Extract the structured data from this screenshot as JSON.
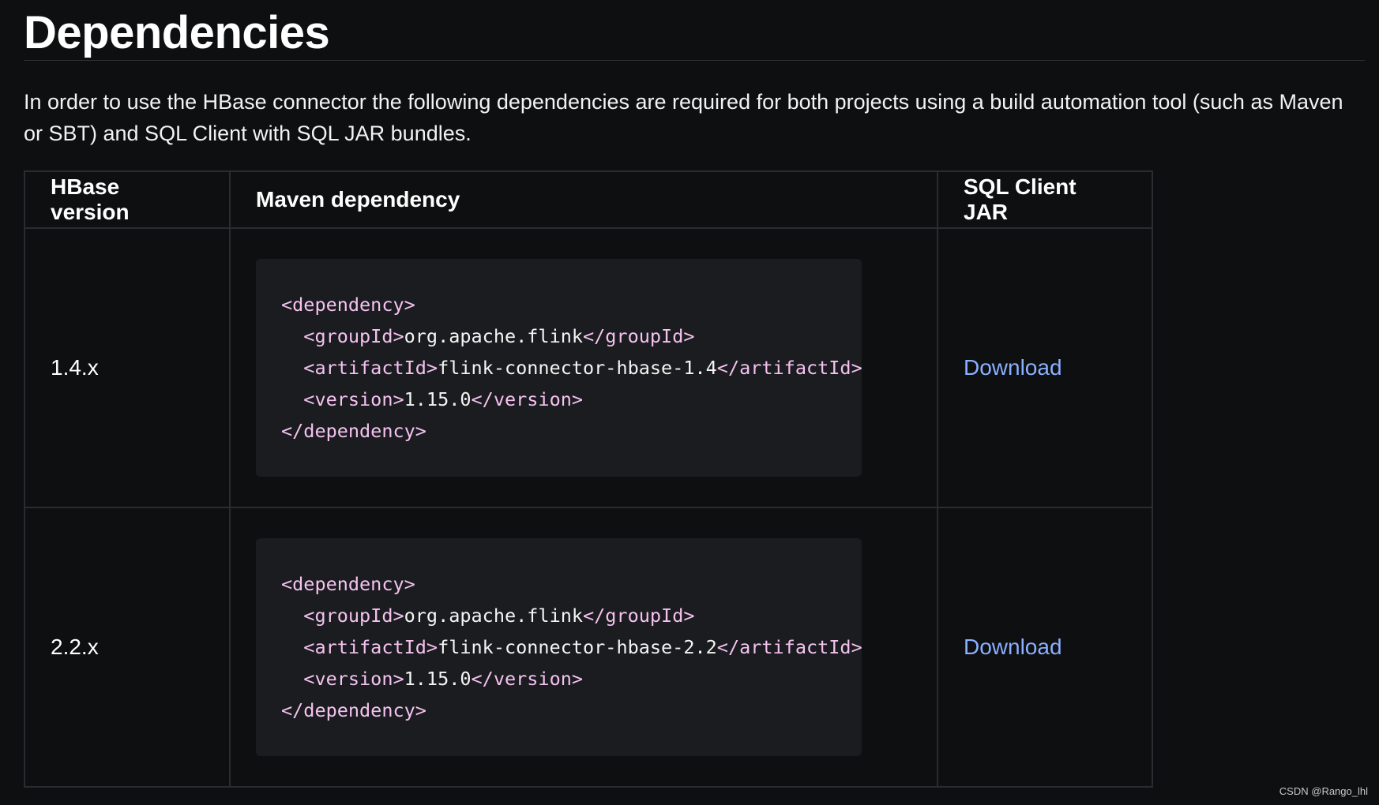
{
  "page": {
    "title": "Dependencies",
    "intro": "In order to use the HBase connector the following dependencies are required for both projects using a build automation tool (such as Maven or SBT) and SQL Client with SQL JAR bundles."
  },
  "table": {
    "headers": [
      "HBase version",
      "Maven dependency",
      "SQL Client JAR"
    ],
    "rows": [
      {
        "version": "1.4.x",
        "code": {
          "l1_open": "<dependency>",
          "l2_open": "<groupId>",
          "l2_val": "org.apache.flink",
          "l2_close": "</groupId>",
          "l3_open": "<artifactId>",
          "l3_val": "flink-connector-hbase-1.4",
          "l3_close": "</artifactId>",
          "l4_open": "<version>",
          "l4_val": "1.15.0",
          "l4_close": "</version>",
          "l5_close": "</dependency>"
        },
        "jar_link": "Download"
      },
      {
        "version": "2.2.x",
        "code": {
          "l1_open": "<dependency>",
          "l2_open": "<groupId>",
          "l2_val": "org.apache.flink",
          "l2_close": "</groupId>",
          "l3_open": "<artifactId>",
          "l3_val": "flink-connector-hbase-2.2",
          "l3_close": "</artifactId>",
          "l4_open": "<version>",
          "l4_val": "1.15.0",
          "l4_close": "</version>",
          "l5_close": "</dependency>"
        },
        "jar_link": "Download"
      }
    ]
  },
  "watermark": "CSDN @Rango_lhl",
  "colors": {
    "background": "#0e0f10",
    "code_background": "#1a1c1f",
    "tag": "#f5c2f0",
    "link": "#8ab0ff",
    "border": "#2a2c2f"
  }
}
